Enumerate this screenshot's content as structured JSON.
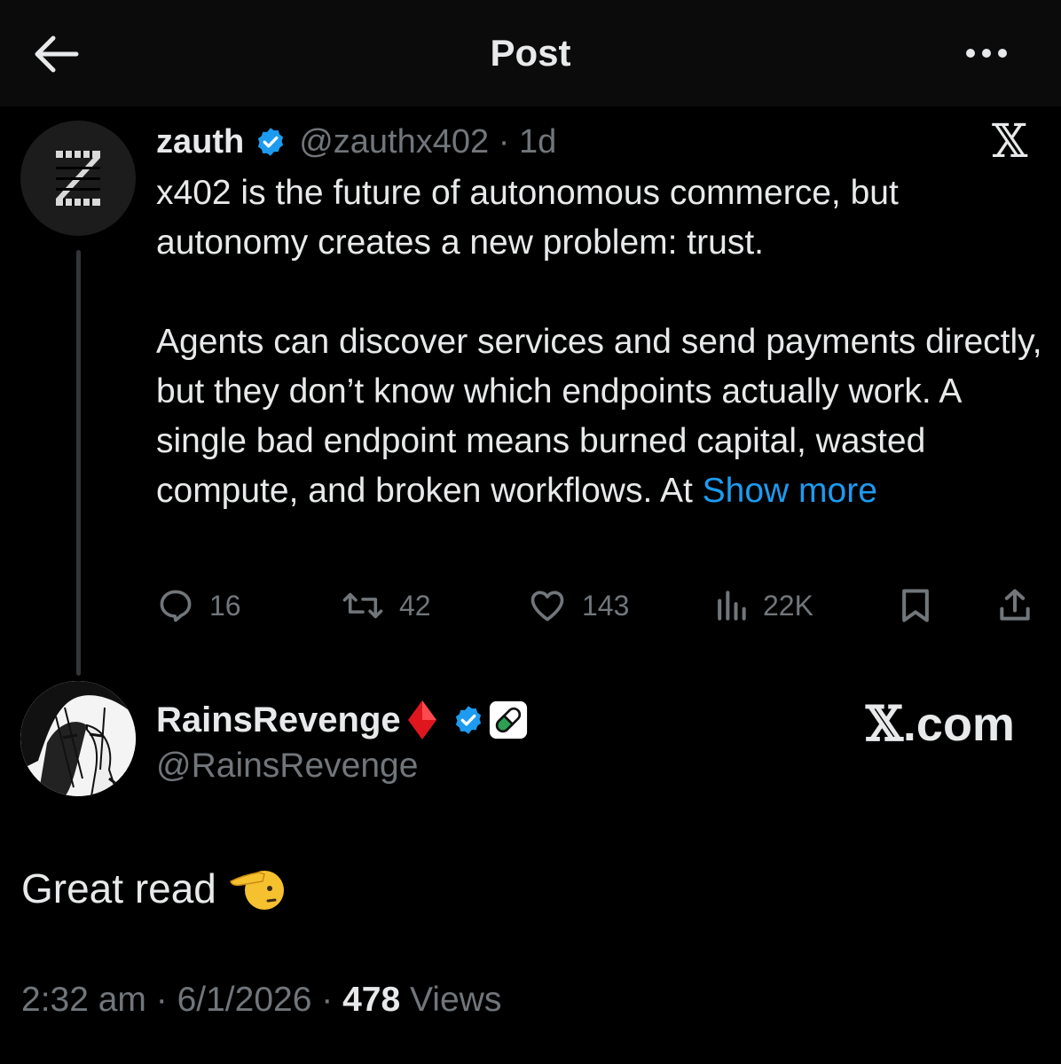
{
  "header": {
    "title": "Post",
    "back_icon": "arrow-left-icon",
    "more_icon": "more-horizontal-icon"
  },
  "quoted_post": {
    "display_name": "zauth",
    "handle": "@zauthx402",
    "age": "1d",
    "paragraph_1": "x402 is the future of autonomous commerce, but autonomy creates a new problem: trust.",
    "paragraph_2": "Agents can discover services and send payments directly, but they don’t know which endpoints actually work. A single bad endpoint means burned capital, wasted compute, and broken workflows. At",
    "show_more": "Show more",
    "stats": {
      "replies": "16",
      "reposts": "42",
      "likes": "143",
      "views": "22K"
    }
  },
  "reply_post": {
    "display_name": "RainsRevenge",
    "handle": "@RainsRevenge",
    "watermark": "X.com",
    "text": "Great read"
  },
  "meta": {
    "time": "2:32 am",
    "date": "6/1/2026",
    "views_count": "478",
    "views_label": "Views"
  },
  "colors": {
    "background": "#000000",
    "header_bg": "#0b0b0b",
    "text_primary": "#e7e9ea",
    "text_secondary": "#71767b",
    "link_blue": "#1d9bf0",
    "verified_blue": "#1d9bf0",
    "diamond_red": "#e0161e"
  }
}
